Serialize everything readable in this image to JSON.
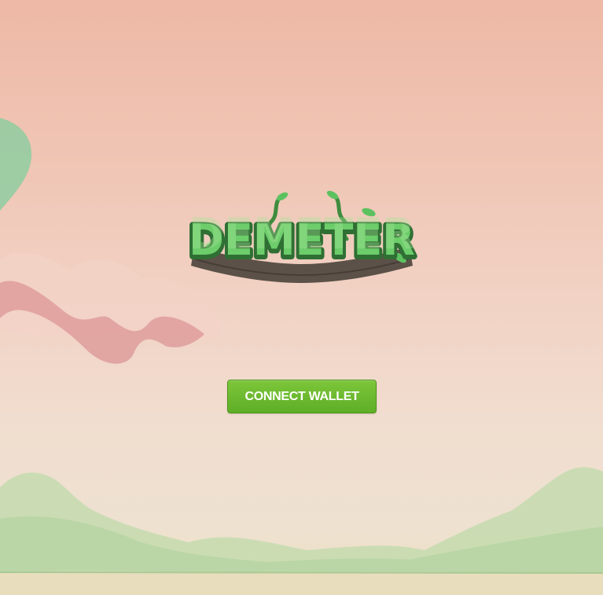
{
  "app": {
    "logo_text": "DEMETER"
  },
  "actions": {
    "connect_label": "CONNECT WALLET"
  },
  "theme": {
    "sky_top": "#eeb9a6",
    "sky_bottom": "#ece0c4",
    "accent": "#6cbb2f",
    "logo_green": "#5cc25f",
    "logo_shadow": "#5b5148"
  }
}
